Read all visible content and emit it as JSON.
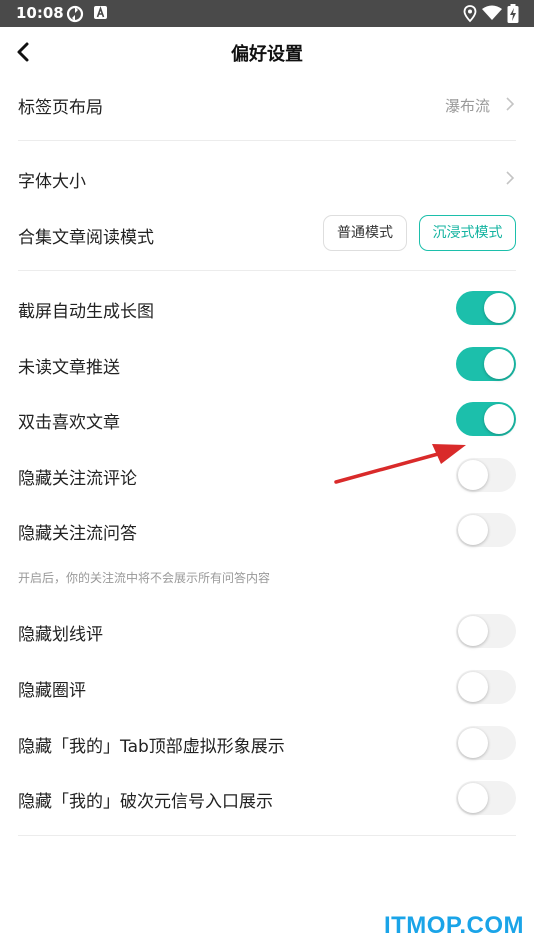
{
  "status_bar": {
    "time": "10:08",
    "icons": [
      "sync-icon",
      "a-badge-icon",
      "location-icon",
      "wifi-icon",
      "battery-charging-icon"
    ]
  },
  "header": {
    "title": "偏好设置"
  },
  "rows": {
    "tab_layout": {
      "label": "标签页布局",
      "value": "瀑布流"
    },
    "font_size": {
      "label": "字体大小"
    },
    "reading_mode": {
      "label": "合集文章阅读模式",
      "options": [
        "普通模式",
        "沉浸式模式"
      ],
      "selected": "沉浸式模式"
    },
    "screenshot_long": {
      "label": "截屏自动生成长图",
      "on": true
    },
    "unread_push": {
      "label": "未读文章推送",
      "on": true
    },
    "double_tap_like": {
      "label": "双击喜欢文章",
      "on": true
    },
    "hide_follow_comments": {
      "label": "隐藏关注流评论",
      "on": false
    },
    "hide_follow_qa": {
      "label": "隐藏关注流问答",
      "on": false
    },
    "hide_follow_qa_hint": "开启后，你的关注流中将不会展示所有问答内容",
    "hide_underline": {
      "label": "隐藏划线评",
      "on": false
    },
    "hide_circle": {
      "label": "隐藏圈评",
      "on": false
    },
    "hide_avatar": {
      "label": "隐藏「我的」Tab顶部虚拟形象展示",
      "on": false
    },
    "hide_ciyuan": {
      "label": "隐藏「我的」破次元信号入口展示",
      "on": false
    }
  },
  "colors": {
    "accent": "#1cbfab",
    "status_bar": "#4a4a4a",
    "annotation_arrow": "#d92a2a",
    "watermark": "#1aa4e8"
  },
  "watermark": "ITMOP.COM"
}
